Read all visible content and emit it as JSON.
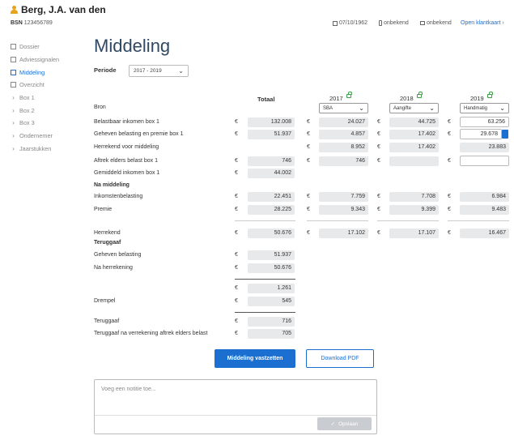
{
  "client": {
    "name": "Berg, J.A. van den",
    "bsn_label": "BSN",
    "bsn": "123456789"
  },
  "header_meta": {
    "birthdate": "07/10/1962",
    "phone": "onbekend",
    "email": "onbekend",
    "open_link": "Open klantkaart ›"
  },
  "sidebar": [
    {
      "label": "Dossier",
      "icon": "folder-icon",
      "kind": "icon",
      "active": false
    },
    {
      "label": "Adviessignalen",
      "icon": "signal-icon",
      "kind": "icon",
      "active": false
    },
    {
      "label": "Middeling",
      "icon": "grid-icon",
      "kind": "icon",
      "active": true
    },
    {
      "label": "Overzicht",
      "icon": "calendar-icon",
      "kind": "icon",
      "active": false
    },
    {
      "label": "Box 1",
      "icon": "chevron-right-icon",
      "kind": "chev",
      "active": false
    },
    {
      "label": "Box 2",
      "icon": "chevron-right-icon",
      "kind": "chev",
      "active": false
    },
    {
      "label": "Box 3",
      "icon": "chevron-right-icon",
      "kind": "chev",
      "active": false
    },
    {
      "label": "Ondernemer",
      "icon": "chevron-right-icon",
      "kind": "chev",
      "active": false
    },
    {
      "label": "Jaarstukken",
      "icon": "chevron-right-icon",
      "kind": "chev",
      "active": false
    }
  ],
  "page": {
    "title": "Middeling",
    "periode_label": "Periode",
    "periode_value": "2017 - 2019",
    "col_totaal": "Totaal",
    "years": [
      {
        "year": "2017",
        "source": "SBA"
      },
      {
        "year": "2018",
        "source": "Aangifte"
      },
      {
        "year": "2019",
        "source": "Handmatig"
      }
    ],
    "currency": "€"
  },
  "labels": {
    "bron": "Bron",
    "belastbaar": "Belastbaar inkomen box 1",
    "geheven": "Geheven belasting en premie box 1",
    "herrekend_voor": "Herrekend voor middeling",
    "aftrek": "Aftrek elders belast box 1",
    "gemiddeld": "Gemiddeld inkomen box 1",
    "na_middeling": "Na middeling",
    "inkomstenbelasting": "Inkomstenbelasting",
    "premie": "Premie",
    "herrekend": "Herrekend",
    "teruggaaf_h": "Teruggaaf",
    "geheven_bel": "Geheven belasting",
    "na_herrekening": "Na herrekening",
    "drempel": "Drempel",
    "teruggaaf": "Teruggaaf",
    "teruggaaf_na": "Teruggaaf na verrekening aftrek elders belast"
  },
  "values": {
    "belastbaar": {
      "totaal": "132.008",
      "y2017": "24.027",
      "y2018": "44.725",
      "y2019": "63.256"
    },
    "geheven": {
      "totaal": "51.937",
      "y2017": "4.857",
      "y2018": "17.402",
      "y2019": "29.678"
    },
    "herrekend_voor": {
      "y2017": "8.952",
      "y2018": "17.402",
      "y2019": "23.883"
    },
    "aftrek": {
      "totaal": "746",
      "y2017": "746",
      "y2018": "",
      "y2019": ""
    },
    "gemiddeld": {
      "totaal": "44.002"
    },
    "inkomstenbelasting": {
      "totaal": "22.451",
      "y2017": "7.759",
      "y2018": "7.708",
      "y2019": "6.984"
    },
    "premie": {
      "totaal": "28.225",
      "y2017": "9.343",
      "y2018": "9.399",
      "y2019": "9.483"
    },
    "herrekend": {
      "totaal": "50.676",
      "y2017": "17.102",
      "y2018": "17.107",
      "y2019": "16.467"
    },
    "geheven_bel": {
      "totaal": "51.937"
    },
    "na_herrekening": {
      "totaal": "50.676"
    },
    "verschil": {
      "totaal": "1.261"
    },
    "drempel": {
      "totaal": "545"
    },
    "teruggaaf": {
      "totaal": "716"
    },
    "teruggaaf_na": {
      "totaal": "705"
    }
  },
  "actions": {
    "vastzetten": "Middeling vastzetten",
    "download": "Download PDF",
    "note_placeholder": "Voeg een notitie toe...",
    "opslaan": "Opslaan"
  },
  "colors": {
    "accent": "#1a6fd1",
    "lock": "#3aa047",
    "user": "#e8a317"
  }
}
